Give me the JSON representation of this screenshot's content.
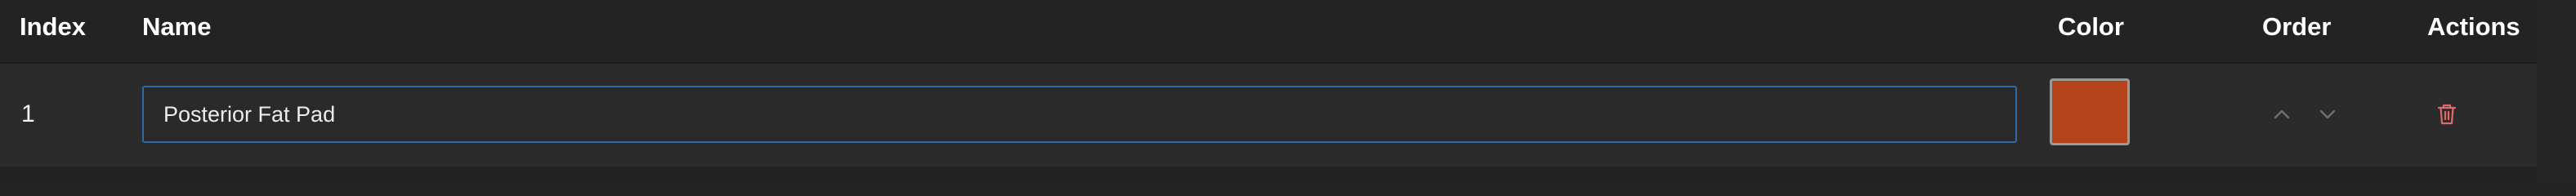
{
  "table": {
    "columns": {
      "index": "Index",
      "name": "Name",
      "color": "Color",
      "order": "Order",
      "actions": "Actions"
    },
    "rows": [
      {
        "index": "1",
        "name": "Posterior Fat Pad",
        "color": "#B5441C"
      }
    ]
  },
  "colors": {
    "background": "#232323",
    "row_background": "#2b2b2b",
    "input_focus_border": "#2f6aa8",
    "order_icon": "#6e6e6e",
    "delete_icon": "#e06a6a"
  },
  "icons": {
    "order_up": "chevron-up-icon",
    "order_down": "chevron-down-icon",
    "delete": "trash-icon"
  }
}
